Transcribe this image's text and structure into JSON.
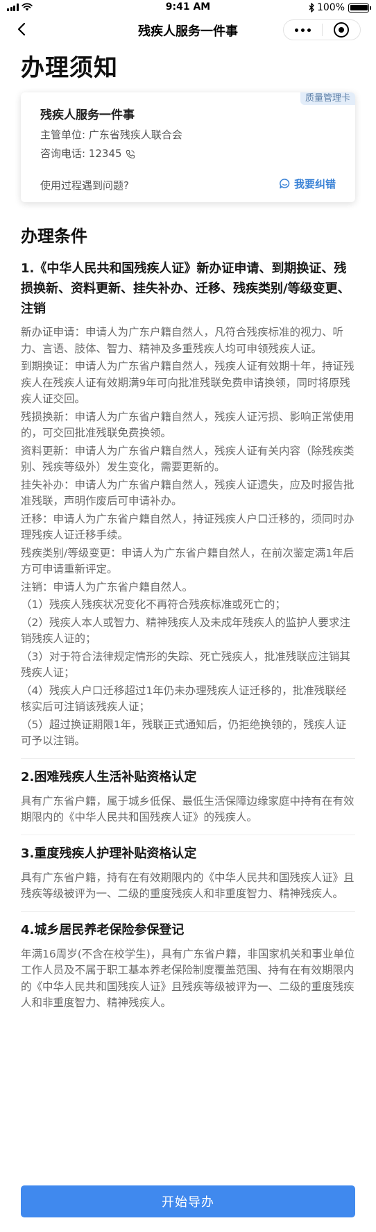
{
  "status_bar": {
    "time": "9:41 AM",
    "battery_text": "100%"
  },
  "nav": {
    "title": "残疾人服务一件事"
  },
  "page": {
    "title": "办理须知"
  },
  "card": {
    "badge": "质量管理卡",
    "name": "残疾人服务一件事",
    "dept": "主管单位: 广东省残疾人联合会",
    "phone": "咨询电话: 12345",
    "help_text": "使用过程遇到问题?",
    "report_label": "我要纠错"
  },
  "section": {
    "title": "办理条件"
  },
  "conditions": [
    {
      "heading": "1.《中华人民共和国残疾人证》新办证申请、到期换证、残损换新、资料更新、挂失补办、迁移、残疾类别/等级变更、注销",
      "paragraphs": [
        "新办证申请：申请人为广东户籍自然人，凡符合残疾标准的视力、听力、言语、肢体、智力、精神及多重残疾人均可申领残疾人证。",
        "到期换证：申请人为广东省户籍自然人，残疾人证有效期十年，持证残疾人在残疾人证有效期满9年可向批准残联免费申请换领，同时将原残疾人证交回。",
        "残损换新：申请人为广东省户籍自然人，残疾人证污损、影响正常使用的，可交回批准残联免费换领。",
        "资料更新：申请人为广东省户籍自然人，残疾人证有关内容（除残疾类别、残疾等级外）发生变化，需要更新的。",
        "挂失补办：申请人为广东省户籍自然人，残疾人证遗失，应及时报告批准残联，声明作废后可申请补办。",
        "迁移：申请人为广东省户籍自然人，持证残疾人户口迁移的，须同时办理残疾人证迁移手续。",
        "残疾类别/等级变更：申请人为广东省户籍自然人，在前次鉴定满1年后方可申请重新评定。",
        "注销：申请人为广东省户籍自然人。",
        "（1）残疾人残疾状况变化不再符合残疾标准或死亡的；",
        "（2）残疾人本人或智力、精神残疾人及未成年残疾人的监护人要求注销残疾人证的；",
        "（3）对于符合法律规定情形的失踪、死亡残疾人，批准残联应注销其残疾人证；",
        "（4）残疾人户口迁移超过1年仍未办理残疾人证迁移的，批准残联经核实后可注销该残疾人证；",
        "（5）超过换证期限1年，残联正式通知后，仍拒绝换领的，残疾人证可予以注销。"
      ]
    },
    {
      "heading": "2.困难残疾人生活补贴资格认定",
      "body": "具有广东省户籍，属于城乡低保、最低生活保障边缘家庭中持有在有效期限内的《中华人民共和国残疾人证》的残疾人。"
    },
    {
      "heading": "3.重度残疾人护理补贴资格认定",
      "body": "具有广东省户籍，持有在有效期限内的《中华人民共和国残疾人证》且残疾等级被评为一、二级的重度残疾人和非重度智力、精神残疾人。"
    },
    {
      "heading": "4.城乡居民养老保险参保登记",
      "body": "年满16周岁(不含在校学生)，具有广东省户籍，非国家机关和事业单位工作人员及不属于职工基本养老保险制度覆盖范围、持有在有效期限内的《中华人民共和国残疾人证》且残疾等级被评为一、二级的重度残疾人和非重度智力、精神残疾人。"
    }
  ],
  "footer": {
    "start_label": "开始导办"
  },
  "colors": {
    "accent": "#4089ee",
    "link": "#3a82d6",
    "badge_bg": "#e3edf9",
    "badge_text": "#5d7fa6"
  }
}
